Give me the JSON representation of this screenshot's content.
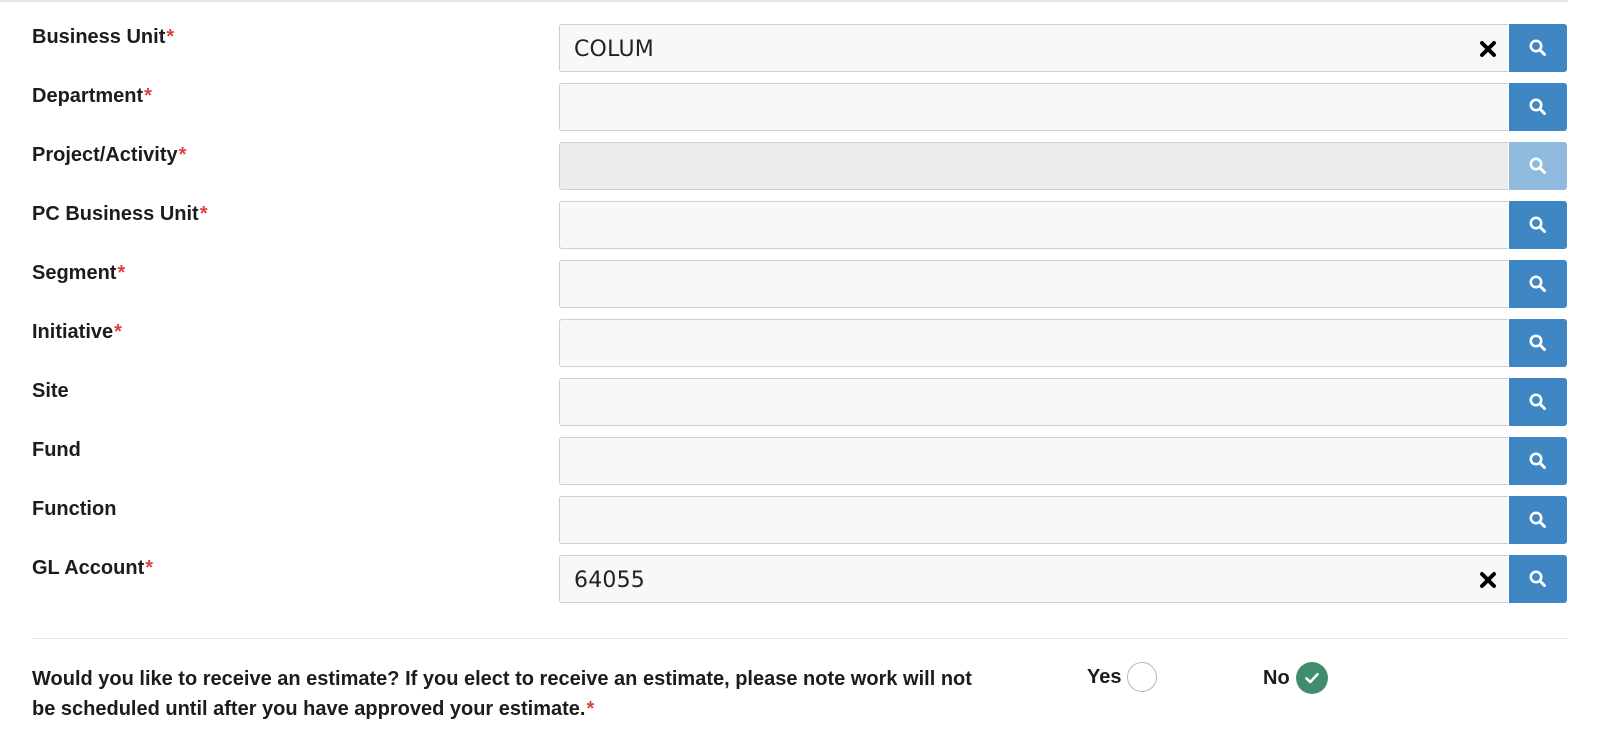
{
  "fields": [
    {
      "label": "Business Unit",
      "required_mark": "*",
      "value": "COLUM"
    },
    {
      "label": "Department",
      "required_mark": "*",
      "value": ""
    },
    {
      "label": "Project/Activity",
      "required_mark": "*",
      "value": ""
    },
    {
      "label": "PC Business Unit",
      "required_mark": "*",
      "value": ""
    },
    {
      "label": "Segment",
      "required_mark": "*",
      "value": ""
    },
    {
      "label": "Initiative",
      "required_mark": "*",
      "value": ""
    },
    {
      "label": "Site",
      "required_mark": "",
      "value": ""
    },
    {
      "label": "Fund",
      "required_mark": "",
      "value": ""
    },
    {
      "label": "Function",
      "required_mark": "",
      "value": ""
    },
    {
      "label": "GL Account",
      "required_mark": "*",
      "value": "64055"
    }
  ],
  "estimate": {
    "question_line1": "Would you like to receive an estimate? If you elect to receive an estimate, please note work will not",
    "question_line2": "be scheduled until after you have approved your estimate.",
    "required_mark": "*",
    "yes_label": "Yes",
    "no_label": "No",
    "selected": "No"
  },
  "icons": {
    "search": "search-icon",
    "clear": "close-icon",
    "check": "check-icon"
  },
  "colors": {
    "primary_button": "#3e86c4",
    "primary_button_disabled": "#8fb9dd",
    "required": "#d9443b",
    "selected_radio": "#3f8d6c"
  }
}
